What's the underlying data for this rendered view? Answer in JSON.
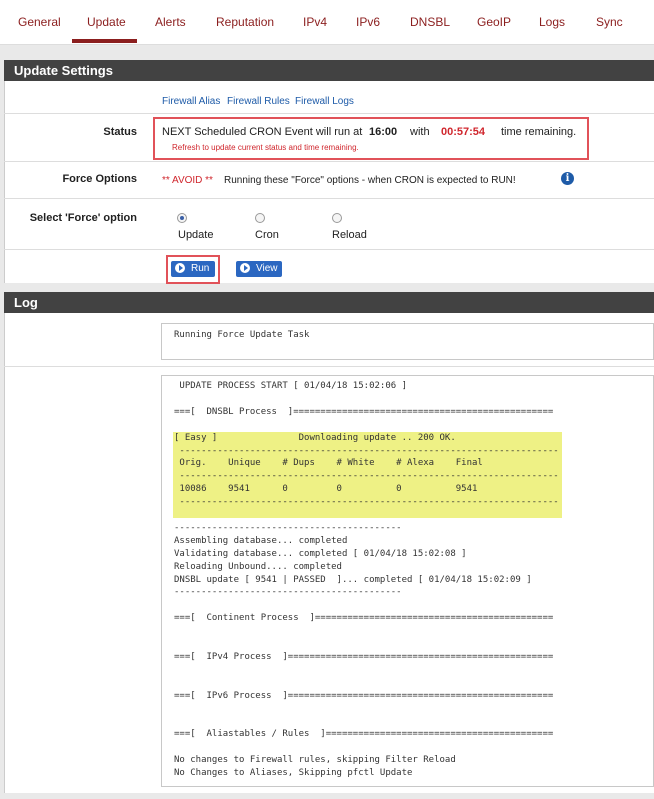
{
  "tabs": [
    {
      "label": "General"
    },
    {
      "label": "Update"
    },
    {
      "label": "Alerts"
    },
    {
      "label": "Reputation"
    },
    {
      "label": "IPv4"
    },
    {
      "label": "IPv6"
    },
    {
      "label": "DNSBL"
    },
    {
      "label": "GeoIP"
    },
    {
      "label": "Logs"
    },
    {
      "label": "Sync"
    }
  ],
  "active_tab": "Update",
  "update_settings": {
    "title": "Update Settings",
    "links": [
      "Firewall Alias",
      "Firewall Rules",
      "Firewall Logs"
    ],
    "status_label": "Status",
    "status_prefix": "NEXT Scheduled CRON Event will run at",
    "status_time": "16:00",
    "status_with": "with",
    "status_remaining": "00:57:54",
    "status_suffix": "time remaining.",
    "status_note": "Refresh to update current status and time remaining.",
    "force_label": "Force Options",
    "force_avoid": "** AVOID **",
    "force_text": "Running these \"Force\" options - when CRON is expected to RUN!",
    "select_label": "Select 'Force' option",
    "options": [
      {
        "label": "Update",
        "checked": true
      },
      {
        "label": "Cron",
        "checked": false
      },
      {
        "label": "Reload",
        "checked": false
      }
    ],
    "run_label": "Run",
    "view_label": "View"
  },
  "log": {
    "title": "Log",
    "task": "Running Force Update Task",
    "lines": [
      " UPDATE PROCESS START [ 01/04/18 15:02:06 ]",
      "",
      "===[  DNSBL Process  ]================================================",
      "",
      "[ Easy ]               Downloading update .. 200 OK.",
      " ----------------------------------------------------------------------",
      " Orig.    Unique    # Dups    # White    # Alexa    Final",
      " ----------------------------------------------------------------------",
      " 10086    9541      0         0          0          9541",
      " ----------------------------------------------------------------------",
      "",
      "------------------------------------------",
      "Assembling database... completed",
      "Validating database... completed [ 01/04/18 15:02:08 ]",
      "Reloading Unbound.... completed",
      "DNSBL update [ 9541 | PASSED  ]... completed [ 01/04/18 15:02:09 ]",
      "------------------------------------------",
      "",
      "===[  Continent Process  ]============================================",
      "",
      "",
      "===[  IPv4 Process  ]=================================================",
      "",
      "",
      "===[  IPv6 Process  ]=================================================",
      "",
      "",
      "===[  Aliastables / Rules  ]==========================================",
      "",
      "No changes to Firewall rules, skipping Filter Reload",
      "No Changes to Aliases, Skipping pfctl Update"
    ]
  },
  "colors": {
    "accent": "#8b1e1e",
    "header_bg": "#424242",
    "highlight": "#eef185",
    "button": "#2b67c1",
    "alert_red": "#d0262d"
  }
}
